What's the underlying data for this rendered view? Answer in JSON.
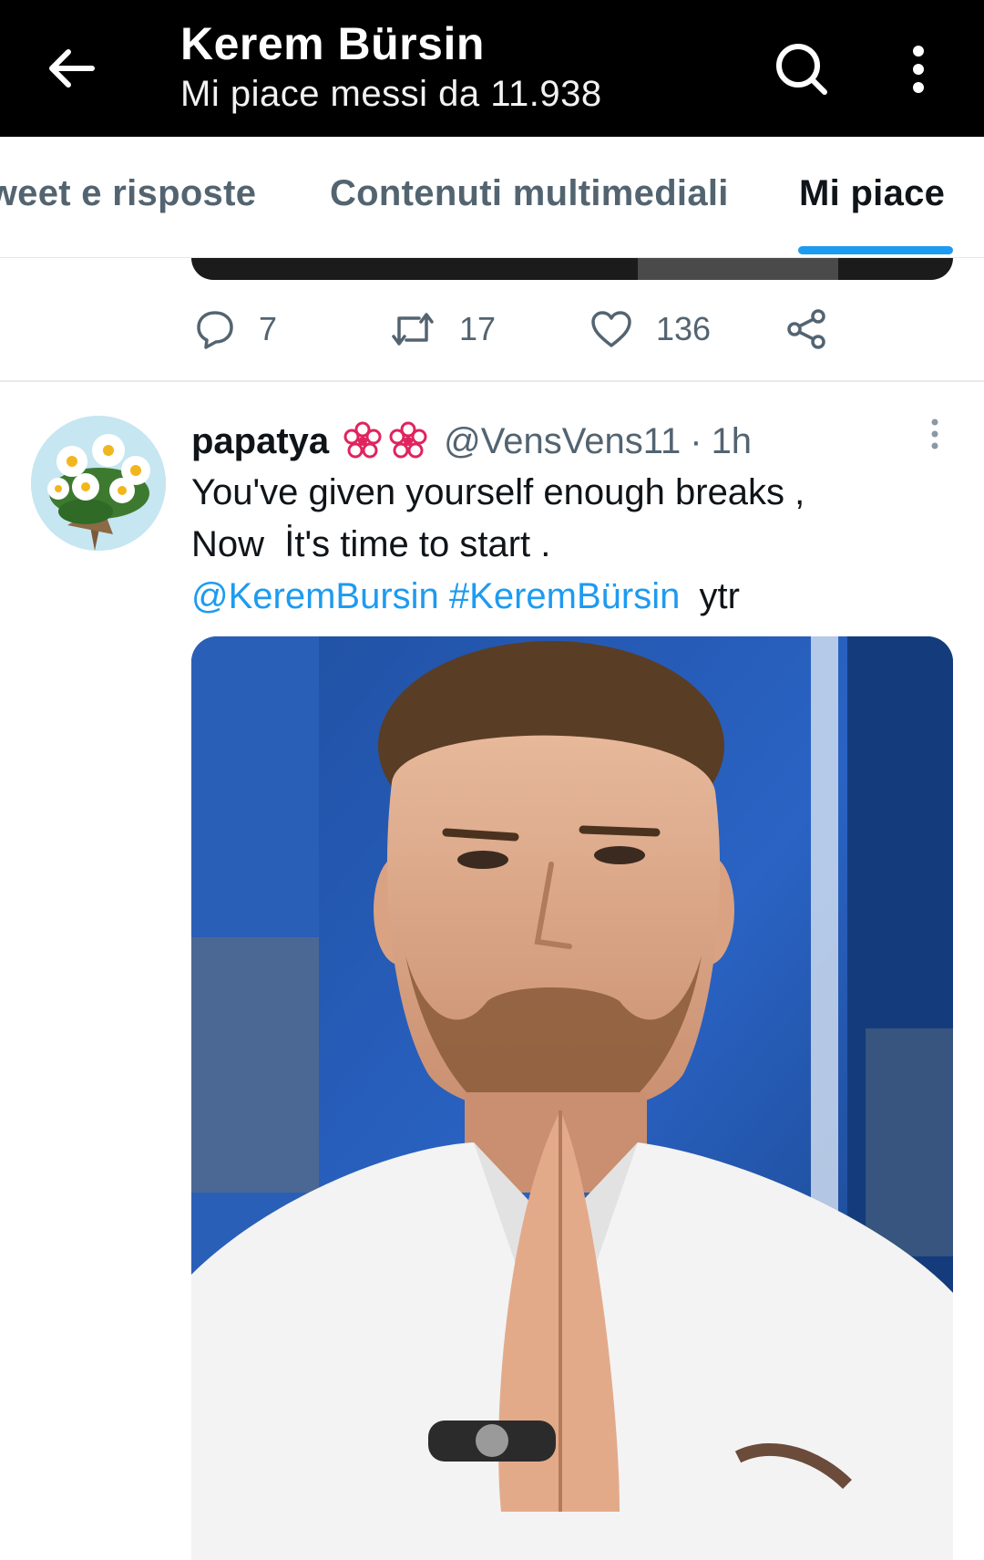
{
  "header": {
    "title": "Kerem Bürsin",
    "subtitle": "Mi piace messi da 11.938",
    "icons": {
      "back": "arrow-left-icon",
      "search": "search-icon",
      "more": "more-vertical-icon"
    }
  },
  "tabs": [
    {
      "label": "Tweet e risposte",
      "active": false
    },
    {
      "label": "Contenuti multimediali",
      "active": false
    },
    {
      "label": "Mi piace",
      "active": true
    }
  ],
  "prev_tweet": {
    "reply_count": "7",
    "retweet_count": "17",
    "like_count": "136"
  },
  "tweet": {
    "display_name": "papatya",
    "handle": "@VensVens11",
    "separator": "·",
    "time": "1h",
    "text_line1": "You've given yourself enough breaks ,",
    "text_line2": "Now  İt's time to start .",
    "mention": "@KeremBursin",
    "hashtag": "#KeremBürsin",
    "trailing": "ytr"
  },
  "colors": {
    "accent": "#1d9bf0",
    "secondary_text": "#536471",
    "header_bg": "#000000",
    "badge": "#e0245e"
  }
}
